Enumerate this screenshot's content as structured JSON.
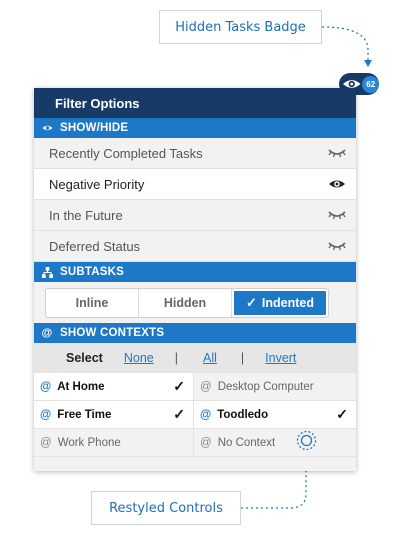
{
  "callouts": {
    "top": "Hidden Tasks Badge",
    "bottom": "Restyled Controls"
  },
  "badge": {
    "icon": "eye-icon",
    "count": "62"
  },
  "panel": {
    "title": "Filter Options",
    "show_hide": {
      "header": "SHOW/HIDE",
      "icon": "eye-icon",
      "rows": [
        {
          "label": "Recently Completed Tasks",
          "state": "hidden",
          "icon": "eye-closed-icon"
        },
        {
          "label": "Negative Priority",
          "state": "shown",
          "icon": "eye-icon"
        },
        {
          "label": "In the Future",
          "state": "hidden",
          "icon": "eye-closed-icon"
        },
        {
          "label": "Deferred Status",
          "state": "hidden",
          "icon": "eye-closed-icon"
        }
      ]
    },
    "subtasks": {
      "header": "SUBTASKS",
      "icon": "hierarchy-icon",
      "options": [
        "Inline",
        "Hidden",
        "Indented"
      ],
      "selected": "Indented",
      "check": "✓"
    },
    "contexts": {
      "header": "SHOW CONTEXTS",
      "icon": "at-icon",
      "select_label": "Select",
      "none": "None",
      "all": "All",
      "invert": "Invert",
      "separator": "|",
      "at": "@",
      "items": [
        {
          "label": "At Home",
          "checked": true
        },
        {
          "label": "Desktop Computer",
          "checked": false
        },
        {
          "label": "Free Time",
          "checked": true
        },
        {
          "label": "Toodledo",
          "checked": true
        },
        {
          "label": "Work Phone",
          "checked": false
        },
        {
          "label": "No Context",
          "checked": false
        }
      ],
      "check": "✓"
    }
  },
  "colors": {
    "title_bar": "#173a66",
    "section_header": "#1e78c8",
    "callout_text": "#1f6fb5"
  }
}
